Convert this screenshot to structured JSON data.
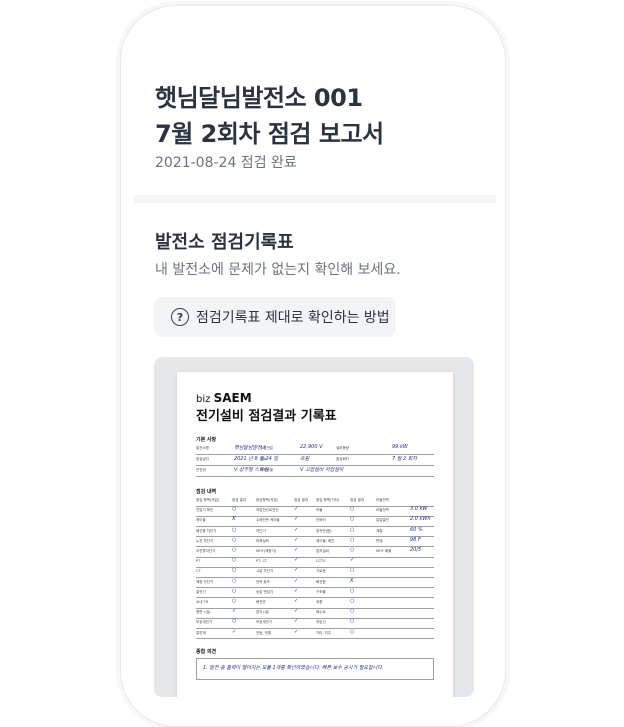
{
  "report": {
    "title_line1": "햇님달님발전소 001",
    "title_line2": "7월 2회차 점검 보고서",
    "subtitle": "2021-08-24 점검 완료"
  },
  "section": {
    "title": "발전소 점검기록표",
    "description": "내 발전소에 문제가 없는지 확인해 보세요.",
    "guide_button_label": "점검기록표 제대로 확인하는 방법",
    "guide_icon": "question-circle-icon"
  },
  "document": {
    "brand_prefix": "biz",
    "brand_name": "SAEM",
    "title": "전기설비 점검결과 기록표",
    "basic_info_heading": "기본 사항",
    "basic_rows": [
      [
        "발전소명",
        "햇님달님발전소",
        "수전전압",
        "22,900 V",
        "설비용량",
        "99 kW"
      ],
      [
        "점검일자",
        "2021 년 8 월 24 일",
        "날씨",
        "흐림",
        "점검회차",
        "7 월 2 회차"
      ],
      [
        "안전위",
        "V 상주형  스트링",
        "계약종별",
        "V 고압설비  저압설비",
        "",
        ""
      ]
    ],
    "details_heading": "점검 내역",
    "header_row": [
      "점검 항목(저압)",
      "점검 결과",
      "점검항목(저압)",
      "점검 결과",
      "점검 항목(기타)",
      "점검 결과",
      "모듈전력",
      ""
    ],
    "detail_rows": [
      [
        "전압기 확인",
        "○",
        "저압전선로전선",
        "✓",
        "모듈",
        "○",
        "모듈전력",
        "3.0 kW"
      ],
      [
        "케이블",
        "X",
        "수배전반 케이블",
        "✓",
        "인버터",
        "○",
        "일일발전",
        "2.0 kWh"
      ],
      [
        "배선용 차단기",
        "○",
        "차단기",
        "✓",
        "접속반(함)",
        "○",
        "계통",
        "60 %"
      ],
      [
        "누전 차단기",
        "○",
        "피뢰설비",
        "✓",
        "케이블, 배관",
        "○",
        "판매",
        "98 F"
      ],
      [
        "과전류차단기",
        "○",
        "MOF(계량기)",
        "✓",
        "접지설비",
        "○",
        "MOF 배율",
        "20/5"
      ],
      [
        "PT",
        "○",
        "PT, CT",
        "✓",
        "CCTV",
        "✓",
        "",
        ""
      ],
      [
        "CT",
        "○",
        "고압 차단기",
        "✓",
        "가로등",
        "○",
        "",
        ""
      ],
      [
        "계량 차단기",
        "○",
        "전력 퓨즈",
        "✓",
        "배전함",
        "X",
        "",
        ""
      ],
      [
        "절연기",
        "○",
        "승압 변압기",
        "✓",
        "구조물",
        "○",
        "",
        ""
      ],
      [
        "소내 TR",
        "○",
        "배전반",
        "✓",
        "외함",
        "○",
        "",
        ""
      ],
      [
        "명판 시설",
        "✓",
        "접지시설",
        "✓",
        "배수로",
        "○",
        "",
        ""
      ],
      [
        "보호계전기",
        "○",
        "보호계전기",
        "✓",
        "저압선",
        "○",
        "",
        ""
      ],
      [
        "절연체",
        "✓",
        "전등, 전열",
        "✓",
        "기타, 지주",
        "○",
        "",
        ""
      ]
    ],
    "overall_heading": "종합 의견",
    "overall_comment": "1. 발전 중 출력이 떨어지는 모듈 1개를 확인하였습니다. 빠른 보수 공사가 필요합니다."
  }
}
